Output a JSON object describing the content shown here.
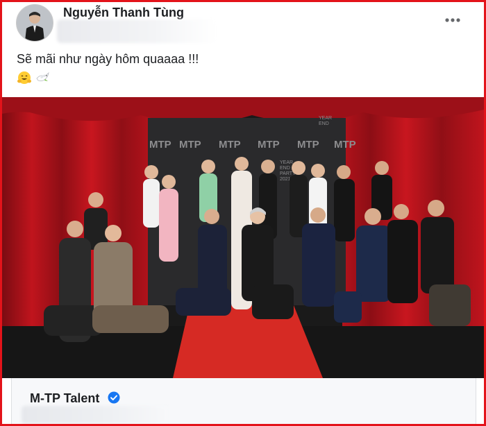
{
  "post": {
    "author": "Nguyễn Thanh Tùng",
    "caption": "Sẽ mãi như ngày hôm quaaaa !!!",
    "emojis": [
      "hugging-face-emoji",
      "dove-emoji"
    ],
    "more_icon": "more-horizontal-icon"
  },
  "photo": {
    "backdrop_brand": "MTP",
    "backdrop_event_lines": [
      "YEAR",
      "END",
      "PARTY",
      "2021"
    ],
    "colors": {
      "curtain": "#b3121b",
      "curtain_dark": "#6e0a10",
      "carpet": "#d62a24",
      "floor": "#1a1a1a",
      "backdrop": "#2a2a2c"
    }
  },
  "shared_page": {
    "name": "M-TP Talent",
    "verified_icon": "verified-badge-icon"
  },
  "colors": {
    "frame": "#e3131a",
    "verified": "#1877f2",
    "text": "#1c1e21",
    "muted": "#65676b"
  }
}
